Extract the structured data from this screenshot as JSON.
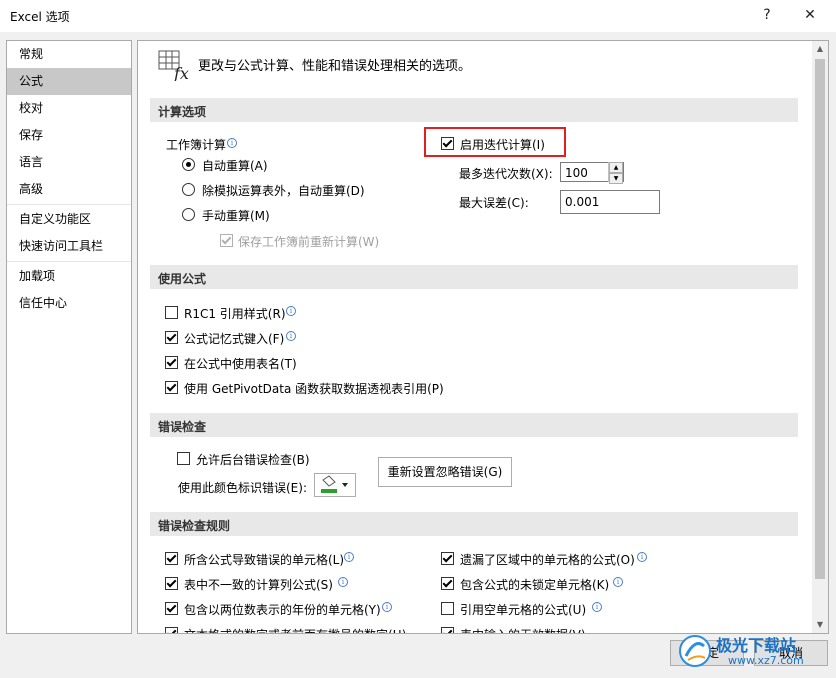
{
  "window": {
    "title": "Excel 选项",
    "help": "?",
    "close": "✕"
  },
  "nav": {
    "items": [
      "常规",
      "公式",
      "校对",
      "保存",
      "语言",
      "高级",
      "自定义功能区",
      "快速访问工具栏",
      "加载项",
      "信任中心"
    ],
    "active_index": 1
  },
  "header": {
    "text": "更改与公式计算、性能和错误处理相关的选项。"
  },
  "calc": {
    "section_title": "计算选项",
    "workbook_calc_label": "工作簿计算",
    "auto": "自动重算(A)",
    "auto_except_tables": "除模拟运算表外，自动重算(D)",
    "manual": "手动重算(M)",
    "recalc_before_save": "保存工作簿前重新计算(W)",
    "iterative": "启用迭代计算(I)",
    "max_iterations_label": "最多迭代次数(X):",
    "max_iterations_value": "100",
    "max_change_label": "最大误差(C):",
    "max_change_value": "0.001"
  },
  "formulas": {
    "section_title": "使用公式",
    "r1c1": "R1C1 引用样式(R)",
    "autocomplete": "公式记忆式键入(F)",
    "table_names": "在公式中使用表名(T)",
    "getpivot": "使用 GetPivotData 函数获取数据透视表引用(P)"
  },
  "errors": {
    "section_title": "错误检查",
    "background_check": "允许后台错误检查(B)",
    "color_label": "使用此颜色标识错误(E):",
    "reset_button": "重新设置忽略错误(G)"
  },
  "rules": {
    "section_title": "错误检查规则",
    "left": [
      "所含公式导致错误的单元格(L)",
      "表中不一致的计算列公式(S)",
      "包含以两位数表示的年份的单元格(Y)",
      "文本格式的数字或者前面有撇号的数字(H)"
    ],
    "right": [
      "遗漏了区域中的单元格的公式(O)",
      "包含公式的未锁定单元格(K)",
      "引用空单元格的公式(U)",
      "表中输入的无效数据(V)"
    ]
  },
  "footer": {
    "ok": "确定",
    "cancel": "取消"
  },
  "watermark": {
    "text": "极光下载站",
    "url": "www.xz7.com"
  },
  "colors": {
    "highlight": "#e02020",
    "active_nav": "#c8c8c8"
  }
}
